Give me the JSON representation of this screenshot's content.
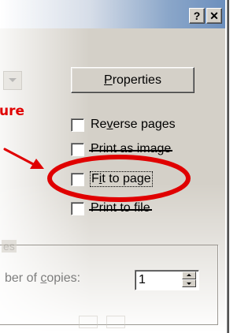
{
  "titlebar": {
    "help_label": "?",
    "close_label": "✕",
    "help_icon": "help-icon",
    "close_icon": "close-icon"
  },
  "printer": {
    "properties_label_underlined": "P",
    "properties_label_rest": "roperties"
  },
  "options": [
    {
      "label_pre": "Re",
      "label_ul": "v",
      "label_post": "erse pages",
      "checked": false,
      "struck": false
    },
    {
      "label": "Print as image",
      "checked": false,
      "struck": true
    },
    {
      "label_pre": "F",
      "label_ul": "i",
      "label_post": "t to page",
      "checked": false,
      "struck": false,
      "focused": true
    },
    {
      "label": "Print to file",
      "checked": false,
      "struck": true
    }
  ],
  "annotation": {
    "text": "ure",
    "color": "#e00000",
    "arrow_icon": "arrow-right-icon",
    "ellipse_icon": "highlight-ellipse-icon"
  },
  "copies": {
    "group_title": "es",
    "label_pre": "ber of ",
    "label_ul": "c",
    "label_post": "opies:",
    "value": "1"
  },
  "colors": {
    "dialog_bg": "#d4d0c8",
    "titlebar_right": "#6c8fbd",
    "annotation_red": "#e00000"
  }
}
